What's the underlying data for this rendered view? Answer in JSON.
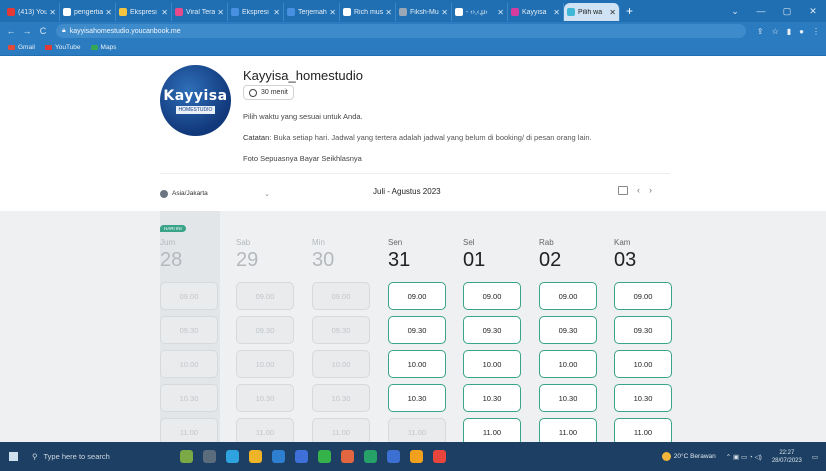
{
  "browser": {
    "tabs": [
      {
        "label": "(413) You",
        "color": "#e53935"
      },
      {
        "label": "pengertia",
        "color": "#ffffff"
      },
      {
        "label": "Ekspresi",
        "color": "#f5c542"
      },
      {
        "label": "Viral Tera",
        "color": "#e84a8a"
      },
      {
        "label": "Ekspresi",
        "color": "#4a90e2"
      },
      {
        "label": "Terjemah",
        "color": "#4a90e2"
      },
      {
        "label": "Rich mus",
        "color": "#ffffff"
      },
      {
        "label": "Fiksh-Mu",
        "color": "#9aa7b4"
      },
      {
        "label": "- ‹›,‹,µ›",
        "color": "#ffffff"
      },
      {
        "label": "Kayyisa",
        "color": "#d63ca0"
      },
      {
        "label": "Pilih wa",
        "color": "#3fb7d6"
      }
    ],
    "new_tab": "+",
    "url": "kayyisahomestudio.youcanbook.me",
    "bookmarks": [
      {
        "label": "Gmail",
        "color": "#e04b3a"
      },
      {
        "label": "YouTube",
        "color": "#e53935"
      },
      {
        "label": "Maps",
        "color": "#34a853"
      }
    ]
  },
  "profile": {
    "logo_text": "Kayyisa",
    "logo_sub": "HOMESTUDIO",
    "title": "Kayyisa_homestudio",
    "duration": "30 menit",
    "intro": "Pilih waktu yang sesuai untuk Anda.",
    "note_label": "Catatan",
    "note_text": ": Buka setiap hari. Jadwal yang tertera adalah jadwal yang belum di booking/ di pesan orang lain.",
    "extra": "Foto Sepuasnya Bayar Seikhlasnya"
  },
  "calendar": {
    "timezone": "Asia/Jakarta",
    "period": "Juli - Agustus 2023",
    "today_badge": "HARI INI",
    "days": [
      {
        "name": "Jum",
        "num": "28",
        "available": false,
        "today": true
      },
      {
        "name": "Sab",
        "num": "29",
        "available": false,
        "today": false
      },
      {
        "name": "Min",
        "num": "30",
        "available": false,
        "today": false
      },
      {
        "name": "Sen",
        "num": "31",
        "available": true,
        "today": false
      },
      {
        "name": "Sel",
        "num": "01",
        "available": true,
        "today": false
      },
      {
        "name": "Rab",
        "num": "02",
        "available": true,
        "today": false
      },
      {
        "name": "Kam",
        "num": "03",
        "available": true,
        "today": false
      }
    ],
    "times": [
      "09.00",
      "09.30",
      "10.00",
      "10.30",
      "11.00"
    ],
    "sen_available_times": [
      "09.00",
      "09.30",
      "10.00",
      "10.30"
    ]
  },
  "taskbar": {
    "search_placeholder": "Type here to search",
    "weather": "20°C  Berawan",
    "time": "22:27",
    "date": "28/07/2023",
    "apps": [
      "#7aa945",
      "#5b6c7d",
      "#2fa3e0",
      "#f0b429",
      "#2f7fd1",
      "#3f6fd8",
      "#35b34a",
      "#e2663f",
      "#26a269",
      "#3b6fd1",
      "#f2a11f",
      "#e8453c"
    ]
  }
}
